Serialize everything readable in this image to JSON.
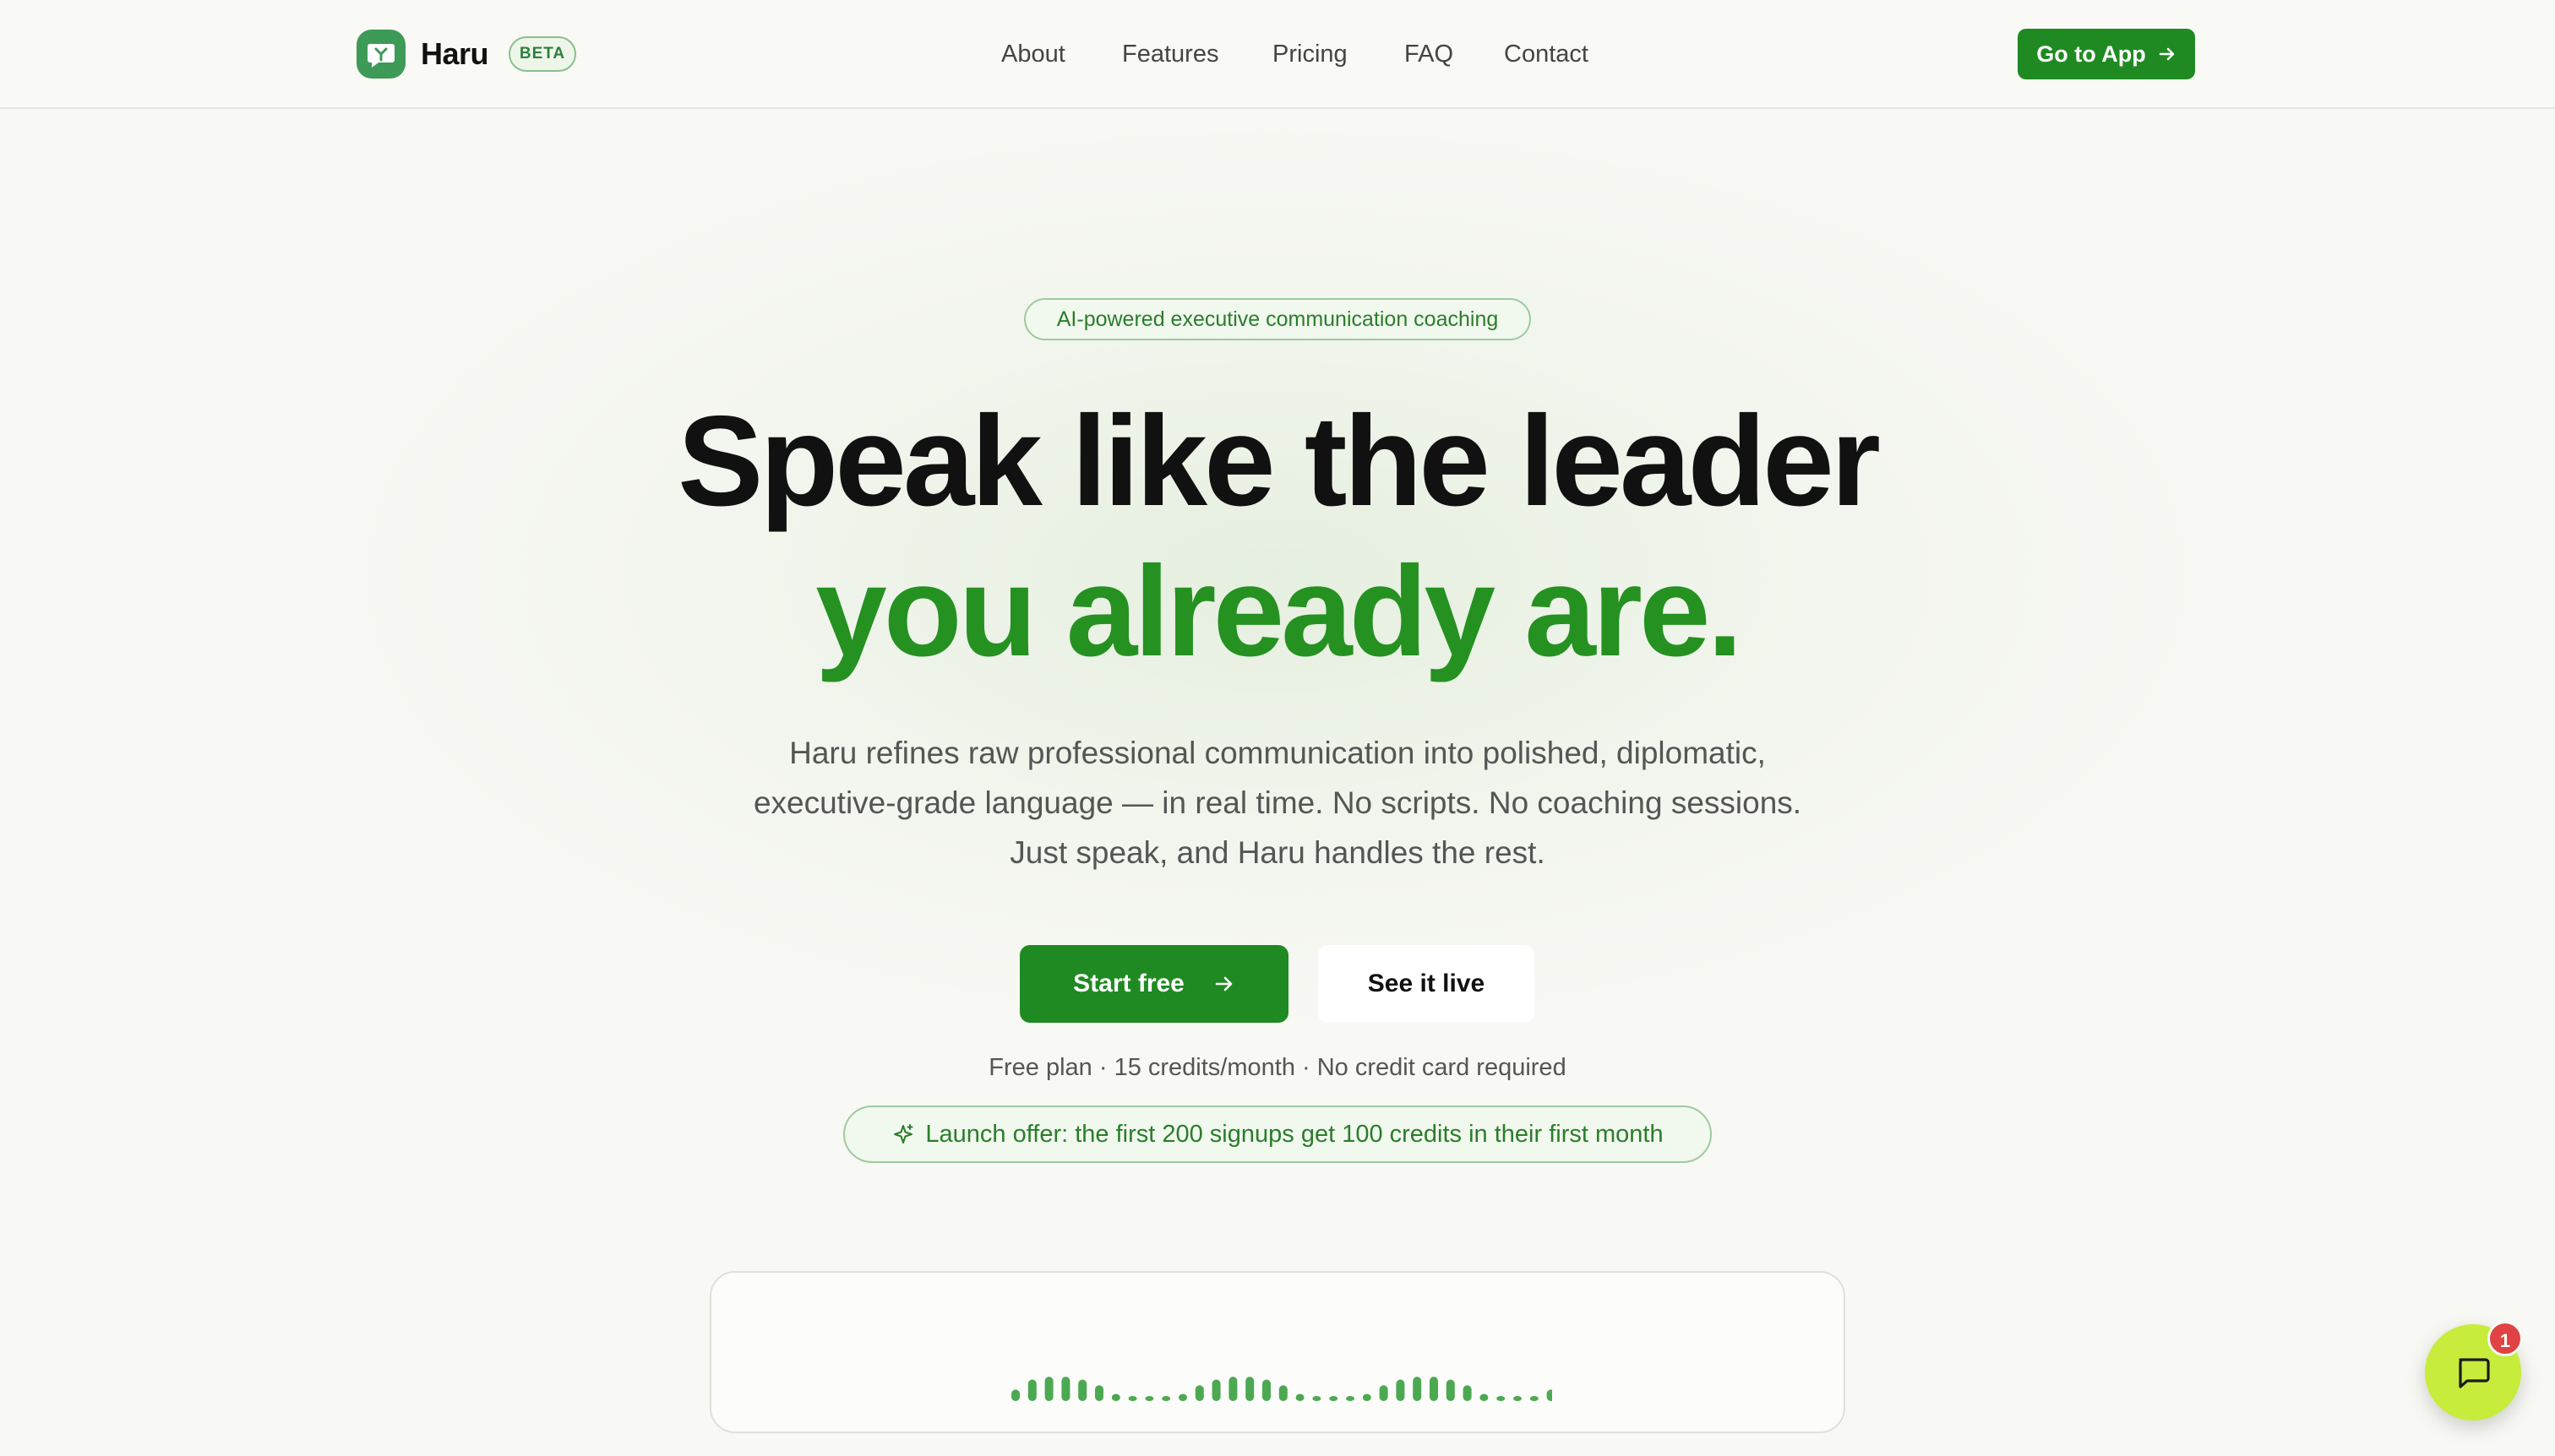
{
  "nav": {
    "brand": "Haru",
    "badge": "BETA",
    "links": [
      "About",
      "Features",
      "Pricing",
      "FAQ",
      "Contact"
    ],
    "cta": "Go to App"
  },
  "hero": {
    "pill": "AI-powered executive communication coaching",
    "headline_1": "Speak like the leader",
    "headline_2": "you already are.",
    "subtitle": [
      "Haru refines raw professional communication into polished, diplomatic,",
      "executive-grade language — in real time. No scripts. No coaching sessions.",
      "Just speak, and Haru handles the rest."
    ],
    "primary_cta": "Start free",
    "secondary_cta": "See it live",
    "plan_note": "Free plan · 15 credits/month · No credit card required",
    "offer": "Launch offer: the first 200 signups get 100 credits in their first month"
  },
  "waveform": {
    "levels": [
      0.4,
      0.75,
      0.85,
      0.85,
      0.75,
      0.55,
      0.25,
      0.15,
      0.15,
      0.15,
      0.25,
      0.55,
      0.75,
      0.85,
      0.85,
      0.75,
      0.55,
      0.25,
      0.15,
      0.15,
      0.15,
      0.25,
      0.55,
      0.75,
      0.85,
      0.85,
      0.75,
      0.55,
      0.25,
      0.15,
      0.15,
      0.15,
      0.4
    ]
  },
  "chat_widget": {
    "unread_count": "1"
  },
  "colors": {
    "brand_green": "#1f8a22",
    "accent_green": "#259121",
    "chat_lime": "#c7ec3c",
    "badge_red": "#e04343"
  },
  "icons": {
    "logo": "chat-bubble-icon",
    "arrow": "arrow-right-icon",
    "sparkle": "sparkle-icon",
    "chat": "message-square-icon"
  }
}
